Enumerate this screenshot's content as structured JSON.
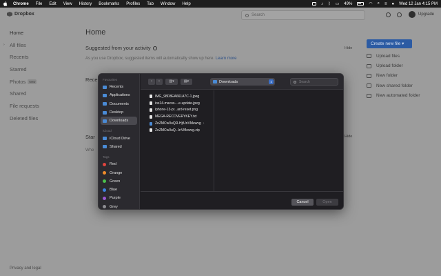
{
  "menubar": {
    "app": "Chrome",
    "items": [
      "File",
      "Edit",
      "View",
      "History",
      "Bookmarks",
      "Profiles",
      "Tab",
      "Window",
      "Help"
    ],
    "battery": "49%",
    "datetime": "Wed 12 Jan  4:15 PM"
  },
  "dropbox": {
    "logo": "Dropbox",
    "search_placeholder": "Search",
    "upgrade": "Upgrade",
    "sidebar": [
      {
        "label": "Home"
      },
      {
        "label": "All files"
      },
      {
        "label": "Recents"
      },
      {
        "label": "Starred"
      },
      {
        "label": "Photos",
        "badge": "New"
      },
      {
        "label": "Shared"
      },
      {
        "label": "File requests"
      },
      {
        "label": "Deleted files"
      }
    ],
    "privacy": "Privacy and legal",
    "main": {
      "title": "Home",
      "suggested_title": "Suggested from your activity",
      "hide": "Hide",
      "suggested_sub": "As you use Dropbox, suggested items will automatically show up here.",
      "learn_more": "Learn more",
      "recents_partial": "Rece",
      "starred_partial": "Star",
      "starred_sub_partial": "Whe",
      "hide2": "Hide"
    },
    "create_button": "Create new file",
    "actions": [
      "Upload files",
      "Upload folder",
      "New folder",
      "New shared folder",
      "New automated folder"
    ]
  },
  "dialog": {
    "favourites_label": "Favourites",
    "favourites": [
      "Recents",
      "Applications",
      "Documents",
      "Desktop",
      "Downloads"
    ],
    "selected_favourite": "Downloads",
    "icloud_label": "iCloud",
    "icloud": [
      "iCloud Drive",
      "Shared"
    ],
    "tags_label": "Tags",
    "tags": [
      {
        "name": "Red",
        "color": "#e0443e"
      },
      {
        "name": "Orange",
        "color": "#f08c2a"
      },
      {
        "name": "Green",
        "color": "#4bbf4b"
      },
      {
        "name": "Blue",
        "color": "#3b82e0"
      },
      {
        "name": "Purple",
        "color": "#9b59d0"
      },
      {
        "name": "Grey",
        "color": "#8e8e93"
      }
    ],
    "location": "Downloads",
    "search_placeholder": "Search",
    "files": [
      {
        "name": "IMG_98D8EA661A7C-1.jpeg",
        "type": "file"
      },
      {
        "name": "ios14-macos-...e-update.jpeg",
        "type": "file"
      },
      {
        "name": "iphone-13-pr...ard-reset.png",
        "type": "file"
      },
      {
        "name": "MEGA-RECOVERYKEY.txt",
        "type": "file"
      },
      {
        "name": "ZoZMCw0uQR-HjtUnVMewvg",
        "type": "folder"
      },
      {
        "name": "ZoZMCw0uQ...lnVMewvg.zip",
        "type": "file"
      }
    ],
    "cancel": "Cancel",
    "open": "Open"
  }
}
